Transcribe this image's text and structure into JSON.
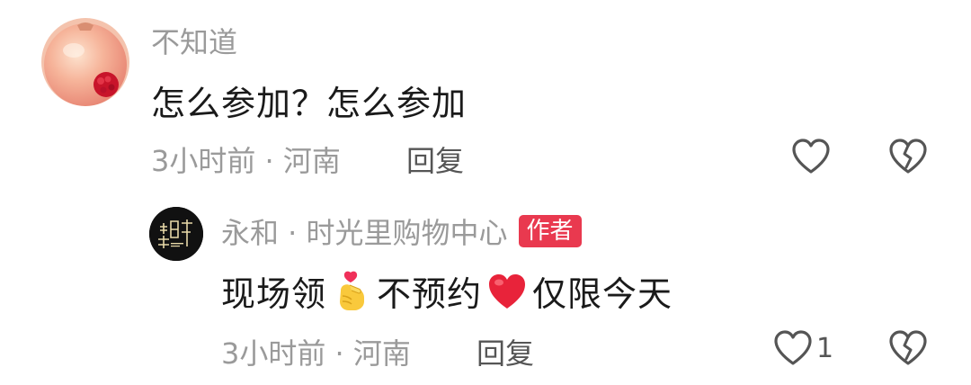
{
  "comments": [
    {
      "username": "不知道",
      "text": "怎么参加？怎么参加",
      "meta": "3小时前 · 河南",
      "reply_label": "回复",
      "avatar_icon": "pomegranate-avatar-icon"
    }
  ],
  "reply": {
    "username": "永和 · 时光里购物中心",
    "author_badge": "作者",
    "text_part1": "现场领",
    "text_part2": "不预约",
    "text_part3": "仅限今天",
    "meta": "3小时前 · 河南",
    "reply_label": "回复",
    "like_count": "1",
    "avatar_icon": "mall-logo-avatar-icon",
    "badge_color": "#e9394f"
  },
  "icons": {
    "like": "heart-outline-icon",
    "dislike": "broken-heart-icon",
    "emoji_1": "finger-heart-emoji",
    "emoji_2": "red-heart-emoji"
  }
}
